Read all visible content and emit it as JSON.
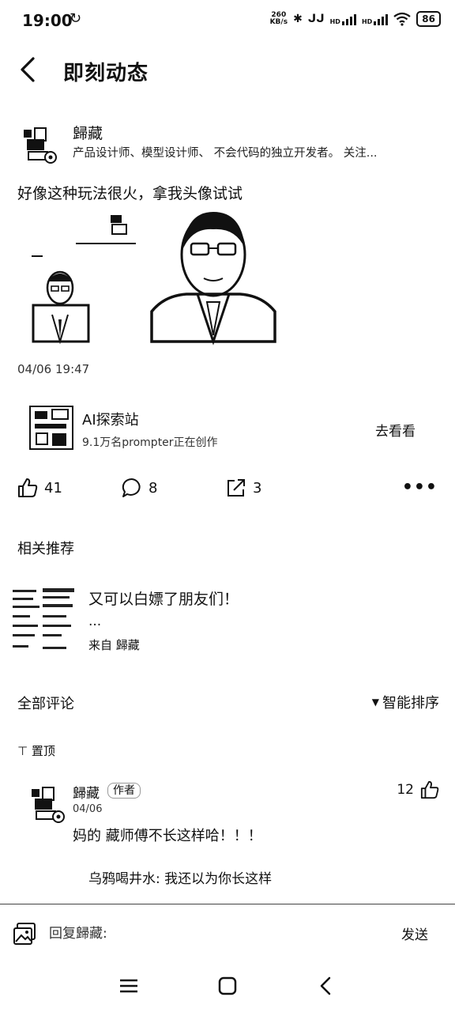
{
  "status_bar": {
    "time": "19:00",
    "speed_value": "260",
    "speed_unit": "KB/s",
    "hd1": "HD",
    "hd2": "HD",
    "battery": "86"
  },
  "header": {
    "title": "即刻动态"
  },
  "post": {
    "author_name": "歸藏",
    "author_bio": "产品设计师、模型设计师、 不会代码的独立开发者。 关注...",
    "text": "好像这种玩法很火，拿我头像试试",
    "timestamp": "04/06 19:47"
  },
  "source": {
    "name": "AI探索站",
    "subtitle": "9.1万名prompter正在创作",
    "action": "去看看"
  },
  "actions": {
    "likes": "41",
    "comments": "8",
    "shares": "3"
  },
  "related": {
    "section_title": "相关推荐",
    "item_title": "又可以白嫖了朋友们！",
    "item_more": "...",
    "item_from": "来自 歸藏"
  },
  "comments": {
    "section_title": "全部评论",
    "sort_label": "智能排序",
    "pinned_label": "置顶",
    "items": [
      {
        "author": "歸藏",
        "badge": "作者",
        "date": "04/06",
        "likes": "12",
        "text": "妈的 藏师傅不长这样哈！！！",
        "reply": "乌鸦喝井水: 我还以为你长这样"
      }
    ]
  },
  "reply_bar": {
    "placeholder": "回复歸藏:",
    "send": "发送"
  }
}
